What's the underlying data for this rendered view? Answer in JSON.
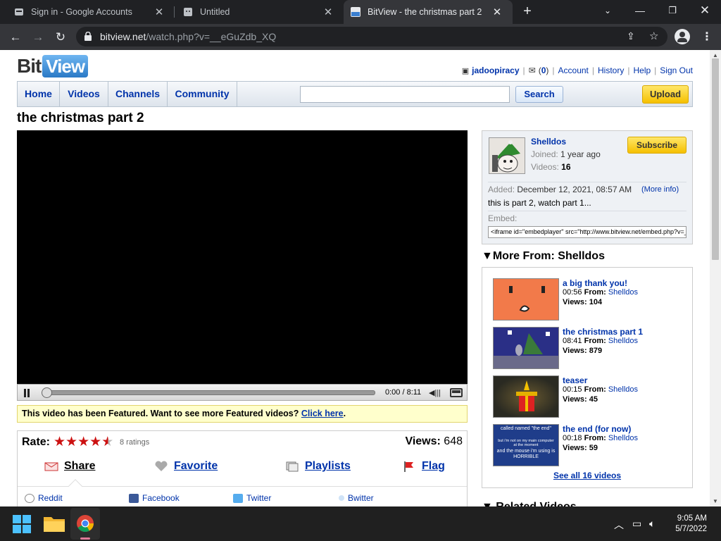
{
  "browser": {
    "tabs": [
      {
        "title": "Sign in - Google Accounts"
      },
      {
        "title": "Untitled"
      },
      {
        "title": "BitView - the christmas part 2"
      }
    ],
    "url_domain": "bitview.net",
    "url_path": "/watch.php?v=__eGuZdb_XQ"
  },
  "site": {
    "logo_left": "Bit",
    "logo_right": "View",
    "user": "jadoopiracy",
    "messages": "(0)",
    "links": [
      "Account",
      "History",
      "Help",
      "Sign Out"
    ],
    "nav": [
      "Home",
      "Videos",
      "Channels",
      "Community"
    ],
    "search_label": "Search",
    "search_value": "",
    "upload_label": "Upload"
  },
  "video": {
    "title": "the christmas part 2",
    "time": "0:00 / 8:11",
    "progress": 0,
    "featured_text": "This video has been Featured. Want to see more Featured videos? ",
    "featured_link": "Click here",
    "featured_end": ".",
    "rate_label": "Rate:",
    "stars": 4.5,
    "ratings": "8 ratings",
    "views_label": "Views:",
    "views": "648",
    "actions": {
      "share": "Share",
      "favorite": "Favorite",
      "playlists": "Playlists",
      "flag": "Flag"
    },
    "share_sites": [
      "Reddit",
      "Facebook",
      "Twitter",
      "Bwitter"
    ]
  },
  "uploader": {
    "name": "Shelldos",
    "joined_label": "Joined:",
    "joined": "1 year ago",
    "videos_label": "Videos:",
    "videos": "16",
    "subscribe": "Subscribe",
    "added_label": "Added:",
    "added": "December 12, 2021, 08:57 AM",
    "more_info": "(More info)",
    "description": "this is part 2, watch part 1...",
    "embed_label": "Embed:",
    "embed_code": "<iframe id=\"embedplayer\" src=\"http://www.bitview.net/embed.php?v=__eGuZdb_XQ\"></iframe>"
  },
  "more_from": {
    "header": "More From: Shelldos",
    "from_label": "From:",
    "views_label": "Views:",
    "items": [
      {
        "title": "a big thank you!",
        "duration": "00:56",
        "author": "Shelldos",
        "views": "104"
      },
      {
        "title": "the christmas part 1",
        "duration": "08:41",
        "author": "Shelldos",
        "views": "879"
      },
      {
        "title": "teaser",
        "duration": "00:15",
        "author": "Shelldos",
        "views": "45"
      },
      {
        "title": "the end (for now)",
        "duration": "00:18",
        "author": "Shelldos",
        "views": "59"
      }
    ],
    "thumb4_text1": "called named \"the end\"",
    "thumb4_text2": "but i'm not on my main computer at the moment",
    "thumb4_text3": "and the mouse i'm using is HORRIBLE",
    "see_all": "See all 16 videos"
  },
  "related_header": "Related Videos",
  "taskbar": {
    "time": "9:05 AM",
    "date": "5/7/2022"
  },
  "colors": {
    "link": "#0033aa",
    "featured_bg": "#ffffcc",
    "star": "#cc1111",
    "tab_active": "#35363a"
  }
}
